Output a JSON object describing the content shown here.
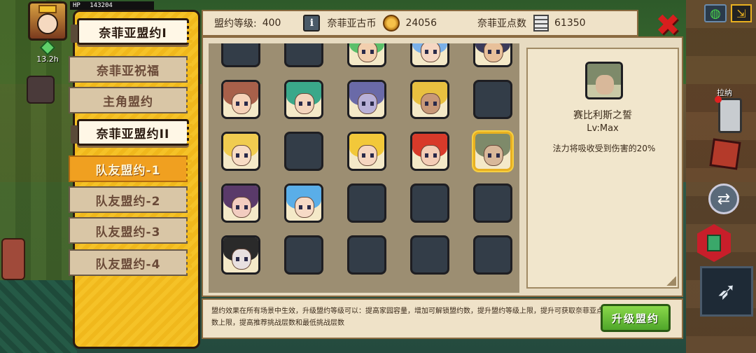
{
  "hud": {
    "hp_label": "HP",
    "hp_value": "143204",
    "timer": "13.2h",
    "map_icon": "globe-icon",
    "exit_icon": "exit-icon",
    "pull_label": "拉纳"
  },
  "tabs": [
    {
      "label": "奈菲亚盟约I",
      "type": "section"
    },
    {
      "label": "奈菲亚祝福",
      "type": "sub"
    },
    {
      "label": "主角盟约",
      "type": "sub"
    },
    {
      "label": "奈菲亚盟约II",
      "type": "section"
    },
    {
      "label": "队友盟约-1",
      "type": "sub",
      "active": true
    },
    {
      "label": "队友盟约-2",
      "type": "sub"
    },
    {
      "label": "队友盟约-3",
      "type": "sub"
    },
    {
      "label": "队友盟约-4",
      "type": "sub"
    }
  ],
  "info_bar": {
    "level_label": "盟约等级:",
    "level_value": "400",
    "coin_label": "奈菲亚古币",
    "coin_value": "24056",
    "points_label": "奈菲亚点数",
    "points_value": "61350"
  },
  "close_icon": "close-x-icon",
  "grid": [
    [
      "empty",
      "empty",
      "portrait",
      "portrait",
      "portrait"
    ],
    [
      "portrait",
      "portrait",
      "portrait",
      "portrait",
      "empty"
    ],
    [
      "portrait",
      "empty",
      "portrait",
      "portrait",
      "selected"
    ],
    [
      "portrait",
      "portrait",
      "empty",
      "empty",
      "empty"
    ],
    [
      "portrait",
      "empty",
      "empty",
      "empty",
      "empty"
    ]
  ],
  "portrait_colors": [
    [
      null,
      null,
      {
        "hair": "#5bbf6a",
        "skin": "#f2cfae"
      },
      {
        "hair": "#7ab0e8",
        "skin": "#f5d6c2"
      },
      {
        "hair": "#3a3a5a",
        "skin": "#e8c09a"
      }
    ],
    [
      {
        "hair": "#a8604a",
        "skin": "#f6d2b8"
      },
      {
        "hair": "#3aa88a",
        "skin": "#f3d4bc"
      },
      {
        "hair": "#6a6aa8",
        "skin": "#b8b0d8"
      },
      {
        "hair": "#e8c040",
        "skin": "#c89878"
      },
      null
    ],
    [
      {
        "hair": "#f0cc50",
        "skin": "#f8dcc4"
      },
      null,
      {
        "hair": "#f2c83a",
        "skin": "#f6d6c0"
      },
      {
        "hair": "#d83a2a",
        "skin": "#f4cdb6"
      },
      {
        "hair": "#7e8a6a",
        "skin": "#d8b89a"
      }
    ],
    [
      {
        "hair": "#5a3a6a",
        "skin": "#f2ccc0"
      },
      {
        "hair": "#5aaee8",
        "skin": "#f6dac6"
      },
      null,
      null,
      null
    ],
    [
      {
        "hair": "#2a2a2a",
        "skin": "#e8e0e0"
      },
      null,
      null,
      null,
      null
    ]
  ],
  "detail": {
    "name": "赛比利斯之誓",
    "level": "Lv:Max",
    "description": "法力将吸收受到伤害的20%"
  },
  "footer": {
    "text": "盟约效果在所有场景中生效，升级盟约等级可以：提高家园容量，增加可解锁盟约数，提升盟约等级上限，提升可获取奈菲亚点数上限，提高推荐挑战层数和最低挑战层数",
    "upgrade_label": "升级盟约"
  },
  "colors": {
    "tab_active": "#f0a020",
    "panel_yellow": "#f5c227",
    "upgrade_green": "#6cc23a",
    "close_red": "#d81e1e"
  }
}
